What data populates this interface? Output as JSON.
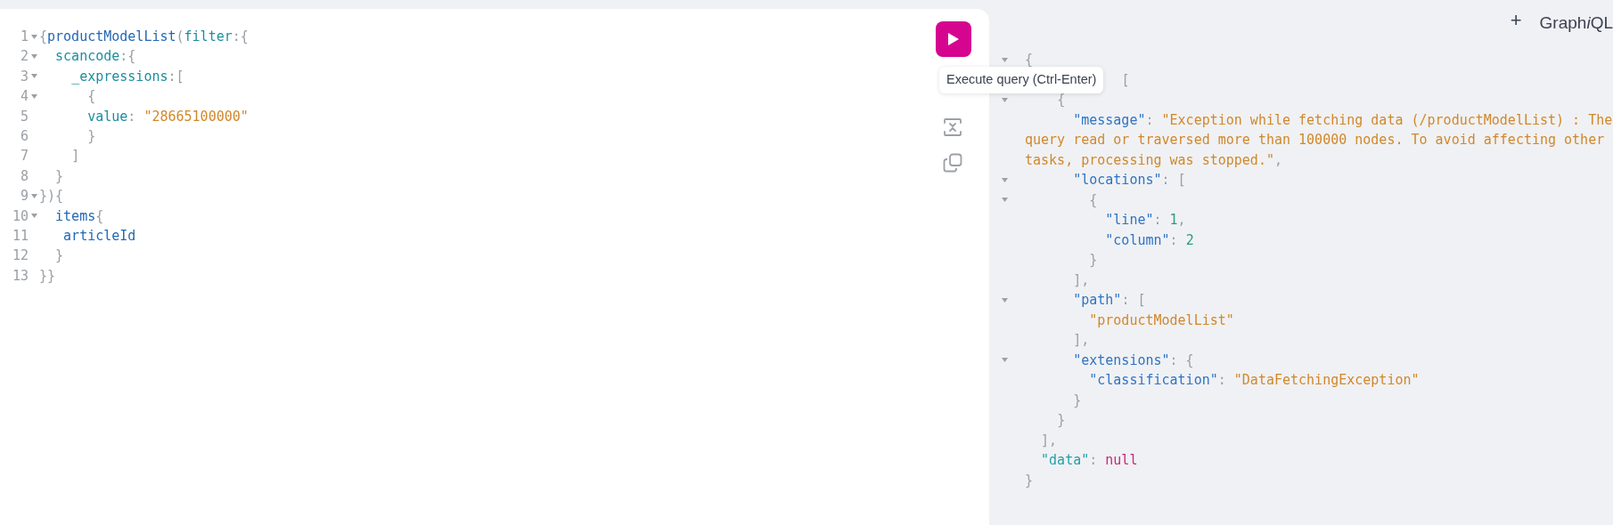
{
  "editor": {
    "lines": [
      {
        "number": "1",
        "foldable": true,
        "tokens": [
          {
            "kind": "punct",
            "text": "{"
          },
          {
            "kind": "field",
            "text": "productModelList"
          },
          {
            "kind": "punct",
            "text": "("
          },
          {
            "kind": "arg",
            "text": "filter"
          },
          {
            "kind": "punct",
            "text": ":{"
          }
        ]
      },
      {
        "number": "2",
        "foldable": true,
        "tokens": [
          {
            "kind": "arg",
            "text": "  scancode"
          },
          {
            "kind": "punct",
            "text": ":{"
          }
        ]
      },
      {
        "number": "3",
        "foldable": true,
        "tokens": [
          {
            "kind": "arg",
            "text": "    _expressions"
          },
          {
            "kind": "punct",
            "text": ":["
          }
        ]
      },
      {
        "number": "4",
        "foldable": true,
        "tokens": [
          {
            "kind": "punct",
            "text": "      {"
          }
        ]
      },
      {
        "number": "5",
        "foldable": false,
        "tokens": [
          {
            "kind": "arg",
            "text": "      value"
          },
          {
            "kind": "punct",
            "text": ": "
          },
          {
            "kind": "string",
            "text": "\"28665100000\""
          }
        ]
      },
      {
        "number": "6",
        "foldable": false,
        "tokens": [
          {
            "kind": "punct",
            "text": "      }"
          }
        ]
      },
      {
        "number": "7",
        "foldable": false,
        "tokens": [
          {
            "kind": "punct",
            "text": "    ]"
          }
        ]
      },
      {
        "number": "8",
        "foldable": false,
        "tokens": [
          {
            "kind": "punct",
            "text": "  }"
          }
        ]
      },
      {
        "number": "9",
        "foldable": true,
        "tokens": [
          {
            "kind": "punct",
            "text": "}){"
          }
        ]
      },
      {
        "number": "10",
        "foldable": true,
        "tokens": [
          {
            "kind": "field",
            "text": "  items"
          },
          {
            "kind": "punct",
            "text": "{"
          }
        ]
      },
      {
        "number": "11",
        "foldable": false,
        "tokens": [
          {
            "kind": "field",
            "text": "   articleId"
          }
        ]
      },
      {
        "number": "12",
        "foldable": false,
        "tokens": [
          {
            "kind": "punct",
            "text": "  }"
          }
        ]
      },
      {
        "number": "13",
        "foldable": false,
        "tokens": [
          {
            "kind": "punct",
            "text": "}}"
          }
        ]
      }
    ]
  },
  "toolbar": {
    "run_tooltip": "Execute query (Ctrl-Enter)"
  },
  "header": {
    "add_tab": "+",
    "logo": [
      {
        "text": "Graph",
        "italic": false
      },
      {
        "text": "i",
        "italic": true
      },
      {
        "text": "QL",
        "italic": false
      }
    ]
  },
  "result": {
    "lines": [
      {
        "foldable": true,
        "tokens": [
          {
            "kind": "punct",
            "text": "{"
          }
        ]
      },
      {
        "foldable": false,
        "tokens": [
          {
            "kind": "punct",
            "text": "            ["
          }
        ]
      },
      {
        "foldable": true,
        "tokens": [
          {
            "kind": "punct",
            "text": "    {"
          }
        ]
      },
      {
        "foldable": false,
        "tokens": [
          {
            "kind": "key",
            "text": "      \"message\""
          },
          {
            "kind": "punct",
            "text": ": "
          },
          {
            "kind": "string",
            "text": "\"Exception while fetching data (/productModelList) : The"
          }
        ]
      },
      {
        "foldable": false,
        "tokens": [
          {
            "kind": "string",
            "text": "query read or traversed more than 100000 nodes. To avoid affecting other"
          }
        ]
      },
      {
        "foldable": false,
        "tokens": [
          {
            "kind": "string",
            "text": "tasks, processing was stopped.\""
          },
          {
            "kind": "punct",
            "text": ","
          }
        ]
      },
      {
        "foldable": true,
        "tokens": [
          {
            "kind": "key",
            "text": "      \"locations\""
          },
          {
            "kind": "punct",
            "text": ": ["
          }
        ]
      },
      {
        "foldable": true,
        "tokens": [
          {
            "kind": "punct",
            "text": "        {"
          }
        ]
      },
      {
        "foldable": false,
        "tokens": [
          {
            "kind": "key",
            "text": "          \"line\""
          },
          {
            "kind": "punct",
            "text": ": "
          },
          {
            "kind": "number",
            "text": "1"
          },
          {
            "kind": "punct",
            "text": ","
          }
        ]
      },
      {
        "foldable": false,
        "tokens": [
          {
            "kind": "key",
            "text": "          \"column\""
          },
          {
            "kind": "punct",
            "text": ": "
          },
          {
            "kind": "number",
            "text": "2"
          }
        ]
      },
      {
        "foldable": false,
        "tokens": [
          {
            "kind": "punct",
            "text": "        }"
          }
        ]
      },
      {
        "foldable": false,
        "tokens": [
          {
            "kind": "punct",
            "text": "      ],"
          }
        ]
      },
      {
        "foldable": true,
        "tokens": [
          {
            "kind": "key",
            "text": "      \"path\""
          },
          {
            "kind": "punct",
            "text": ": ["
          }
        ]
      },
      {
        "foldable": false,
        "tokens": [
          {
            "kind": "string",
            "text": "        \"productModelList\""
          }
        ]
      },
      {
        "foldable": false,
        "tokens": [
          {
            "kind": "punct",
            "text": "      ],"
          }
        ]
      },
      {
        "foldable": true,
        "tokens": [
          {
            "kind": "key",
            "text": "      \"extensions\""
          },
          {
            "kind": "punct",
            "text": ": {"
          }
        ]
      },
      {
        "foldable": false,
        "tokens": [
          {
            "kind": "key",
            "text": "        \"classification\""
          },
          {
            "kind": "punct",
            "text": ": "
          },
          {
            "kind": "string",
            "text": "\"DataFetchingException\""
          }
        ]
      },
      {
        "foldable": false,
        "tokens": [
          {
            "kind": "punct",
            "text": "      }"
          }
        ]
      },
      {
        "foldable": false,
        "tokens": [
          {
            "kind": "punct",
            "text": "    }"
          }
        ]
      },
      {
        "foldable": false,
        "tokens": [
          {
            "kind": "punct",
            "text": "  ],"
          }
        ]
      },
      {
        "foldable": false,
        "tokens": [
          {
            "kind": "property",
            "text": "  \"data\""
          },
          {
            "kind": "punct",
            "text": ": "
          },
          {
            "kind": "null",
            "text": "null"
          }
        ]
      },
      {
        "foldable": false,
        "tokens": [
          {
            "kind": "punct",
            "text": "}"
          }
        ]
      }
    ]
  }
}
